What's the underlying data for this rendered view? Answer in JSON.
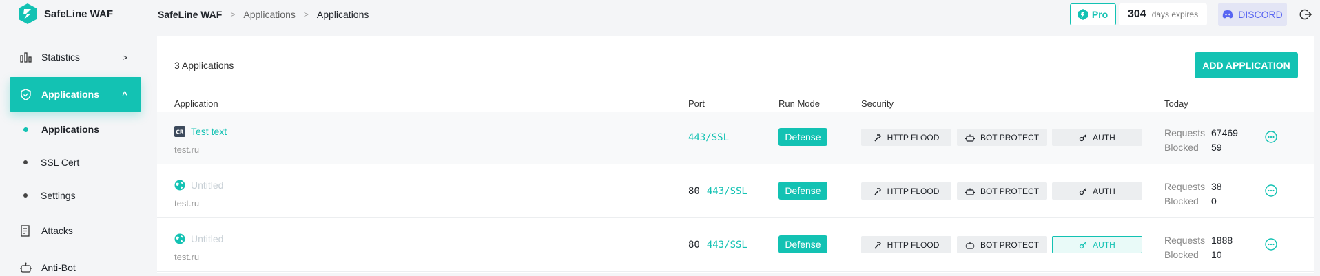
{
  "brand": "SafeLine WAF",
  "breadcrumb": [
    "SafeLine WAF",
    "Applications",
    "Applications"
  ],
  "header": {
    "pro_label": "Pro",
    "days_count": "304",
    "days_label": "days expires",
    "discord_label": "DISCORD"
  },
  "sidebar": {
    "items": [
      {
        "label": "Statistics",
        "icon": "bar-chart-icon"
      },
      {
        "label": "Applications",
        "icon": "shield-icon"
      },
      {
        "label": "Attacks",
        "icon": "attack-list-icon"
      },
      {
        "label": "Anti-Bot",
        "icon": "robot-icon"
      }
    ],
    "subitems": [
      {
        "label": "Applications"
      },
      {
        "label": "SSL Cert"
      },
      {
        "label": "Settings"
      }
    ]
  },
  "main": {
    "count_label": "3 Applications",
    "add_button": "ADD APPLICATION",
    "columns": [
      "Application",
      "Port",
      "Run Mode",
      "Security",
      "Today"
    ],
    "rows": [
      {
        "icon_text": "CR",
        "name": "Test text",
        "domain": "test.ru",
        "port_plain": "",
        "port_ssl": "443/SSL",
        "mode": "Defense",
        "security": [
          "HTTP FLOOD",
          "BOT PROTECT",
          "AUTH"
        ],
        "auth_enabled": false,
        "requests_label": "Requests",
        "requests": "67469",
        "blocked_label": "Blocked",
        "blocked": "59"
      },
      {
        "icon_text": "",
        "name": "Untitled",
        "domain": "test.ru",
        "port_plain": "80",
        "port_ssl": "443/SSL",
        "mode": "Defense",
        "security": [
          "HTTP FLOOD",
          "BOT PROTECT",
          "AUTH"
        ],
        "auth_enabled": false,
        "requests_label": "Requests",
        "requests": "38",
        "blocked_label": "Blocked",
        "blocked": "0"
      },
      {
        "icon_text": "",
        "name": "Untitled",
        "domain": "test.ru",
        "port_plain": "80",
        "port_ssl": "443/SSL",
        "mode": "Defense",
        "security": [
          "HTTP FLOOD",
          "BOT PROTECT",
          "AUTH"
        ],
        "auth_enabled": true,
        "requests_label": "Requests",
        "requests": "1888",
        "blocked_label": "Blocked",
        "blocked": "10"
      }
    ]
  },
  "colors": {
    "accent": "#13c2b3",
    "discord": "#5865f2"
  }
}
